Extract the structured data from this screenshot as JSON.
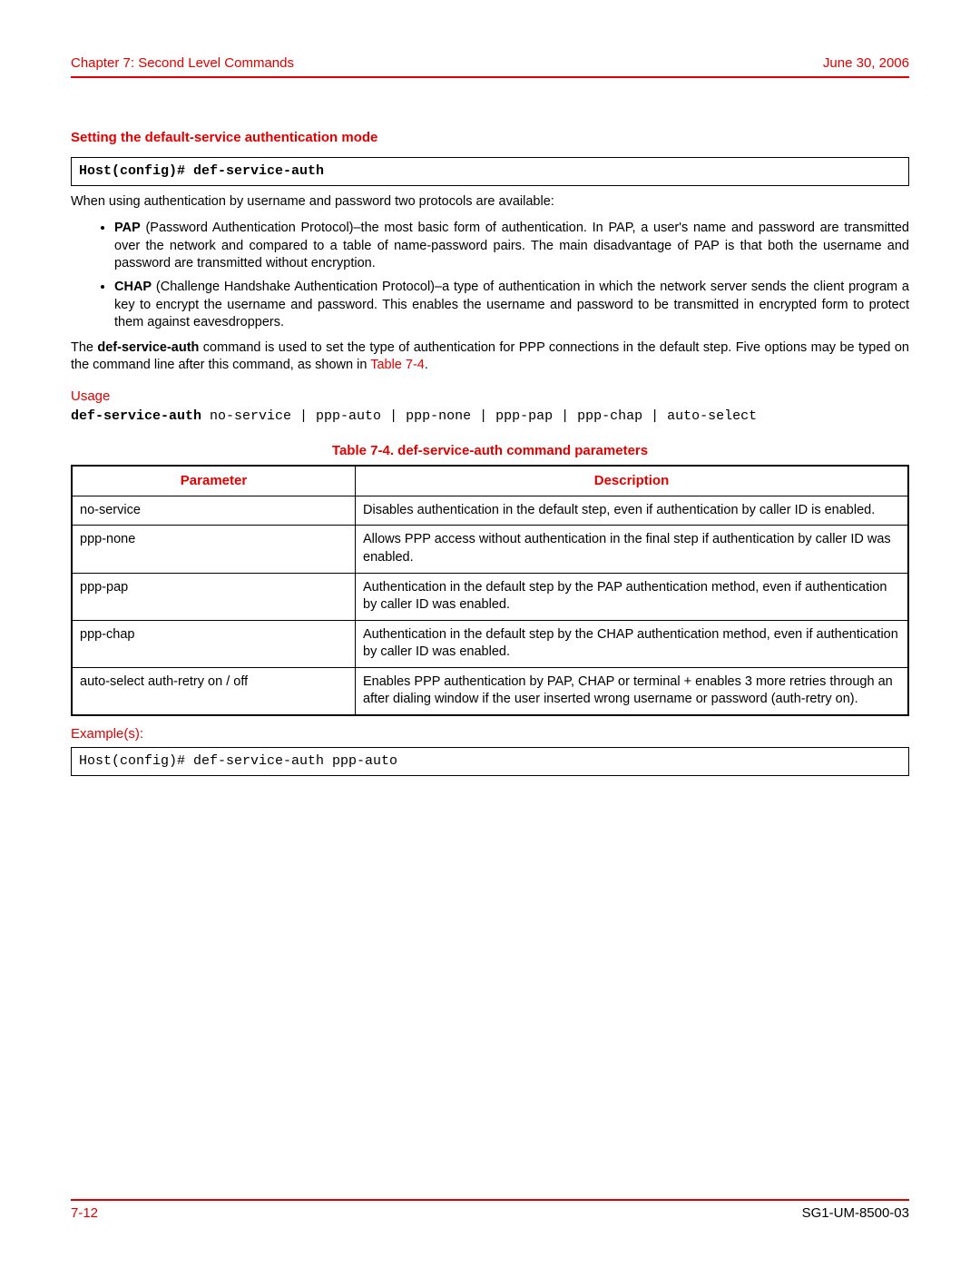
{
  "header": {
    "chapter": "Chapter 7: Second Level Commands",
    "date": "June 30, 2006"
  },
  "section_title": "Setting the default-service authentication mode",
  "cmd_box": "Host(config)# def-service-auth",
  "intro": "When using authentication by username and password two protocols are available:",
  "bullets": {
    "pap_label": "PAP",
    "pap_text": " (Password Authentication Protocol)–the most basic form of authentication. In PAP, a user's name and password are transmitted over the network and compared to a table of name-password pairs. The main disadvantage of PAP is that both the username and password are transmitted without encryption.",
    "chap_label": "CHAP",
    "chap_text": " (Challenge Handshake Authentication Protocol)–a type of authentication in which the network server sends the client program a key to encrypt the username and password. This enables the username and password to be transmitted in encrypted form to protect them against eavesdroppers."
  },
  "explain_pre": "The ",
  "explain_cmd": "def-service-auth",
  "explain_mid": " command is used to set the type of authentication for PPP connections in the default step. Five options may be typed on the command line after this command, as shown in ",
  "explain_ref": "Table 7-4",
  "explain_post": ".",
  "usage_label": "Usage",
  "usage_cmd": "def-service-auth",
  "usage_rest": " no-service | ppp-auto | ppp-none | ppp-pap | ppp-chap | auto-select",
  "table_caption": "Table 7-4. def-service-auth command parameters",
  "table_headers": {
    "param": "Parameter",
    "desc": "Description"
  },
  "table_rows": [
    {
      "param": "no-service",
      "desc": "Disables authentication in the default step, even if authentication by caller ID is enabled."
    },
    {
      "param": "ppp-none",
      "desc": "Allows PPP access without authentication in the final step if authentication by caller ID was enabled."
    },
    {
      "param": "ppp-pap",
      "desc": "Authentication in the default step by the PAP authentication method, even if authentication by caller ID was enabled."
    },
    {
      "param": "ppp-chap",
      "desc": "Authentication in the default step by the CHAP authentication method, even if authentication by caller ID was enabled."
    },
    {
      "param": "auto-select auth-retry on / off",
      "desc": "Enables PPP authentication by PAP, CHAP or terminal + enables 3 more retries through an after dialing window if the user inserted wrong username or password (auth-retry on)."
    }
  ],
  "examples_label": "Example(s):",
  "example_box": "Host(config)# def-service-auth ppp-auto",
  "footer": {
    "page": "7-12",
    "doc": "SG1-UM-8500-03"
  }
}
